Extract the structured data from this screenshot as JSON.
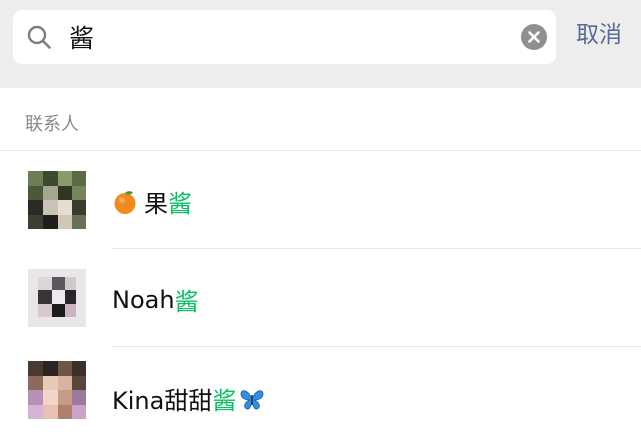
{
  "search": {
    "query": "酱",
    "cancel_label": "取消"
  },
  "section": {
    "label": "联系人"
  },
  "contacts": [
    {
      "prefix": "果",
      "match": "酱",
      "suffix": "",
      "leading_icon": "orange-emoji",
      "trailing_icon": ""
    },
    {
      "prefix": "Noah",
      "match": "酱",
      "suffix": "",
      "leading_icon": "",
      "trailing_icon": ""
    },
    {
      "prefix": "Kina甜甜",
      "match": "酱",
      "suffix": "",
      "leading_icon": "",
      "trailing_icon": "butterfly-emoji"
    }
  ],
  "colors": {
    "highlight": "#07c160",
    "cancel": "#576b95",
    "topbar_bg": "#ededed"
  }
}
